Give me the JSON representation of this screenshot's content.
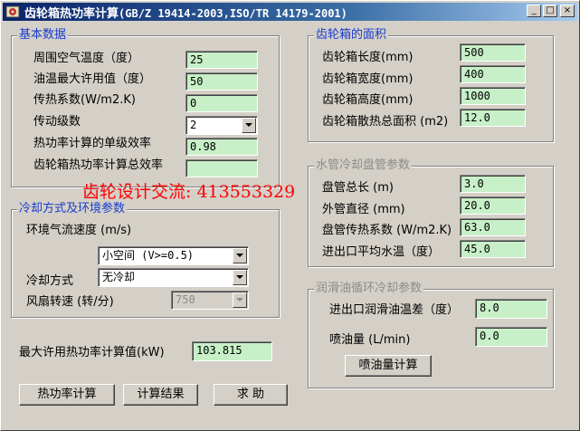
{
  "window": {
    "title_cn": "齿轮箱热功率计算",
    "title_std": "(GB/Z 19414-2003,ISO/TR 14179-2001)",
    "minimize": "_",
    "maximize": "□",
    "close": "×"
  },
  "basic": {
    "group_label": "基本数据",
    "ambient_temp_label": "周围空气温度（度）",
    "ambient_temp_value": "25",
    "max_oil_temp_label": "油温最大许用值（度）",
    "max_oil_temp_value": "50",
    "heat_coef_label": "传热系数(W/m2.K)",
    "heat_coef_value": "0",
    "stages_label": "传动级数",
    "stages_value": "2",
    "stage_eff_label": "热功率计算的单级效率",
    "stage_eff_value": "0.98",
    "total_eff_label": "齿轮箱热功率计算总效率",
    "total_eff_value": ""
  },
  "watermark": "齿轮设计交流: 413553329",
  "cooling": {
    "group_label": "冷却方式及环境参数",
    "airflow_label": "环境气流速度 (m/s)",
    "airflow_value": "小空间  (V>=0.5)",
    "method_label": "冷却方式",
    "method_value": "无冷却",
    "fan_label": "风扇转速 (转/分)",
    "fan_value": "750"
  },
  "result": {
    "max_power_label": "最大许用热功率计算值(kW)",
    "max_power_value": "103.815"
  },
  "buttons": {
    "calc": "热功率计算",
    "results": "计算结果",
    "help": "求 助",
    "oil_calc": "喷油量计算"
  },
  "area": {
    "group_label": "齿轮箱的面积",
    "length_label": "齿轮箱长度(mm)",
    "length_value": "500",
    "width_label": "齿轮箱宽度(mm)",
    "width_value": "400",
    "height_label": "齿轮箱高度(mm)",
    "height_value": "1000",
    "total_area_label": "齿轮箱散热总面积 (m2)",
    "total_area_value": "12.0"
  },
  "water": {
    "group_label": "水管冷却盘管参数",
    "coil_length_label": "盘管总长 (m)",
    "coil_length_value": "3.0",
    "outer_dia_label": "外管直径 (mm)",
    "outer_dia_value": "20.0",
    "coil_heat_label": "盘管传热系数 (W/m2.K)",
    "coil_heat_value": "63.0",
    "water_temp_label": "进出口平均水温（度）",
    "water_temp_value": "45.0"
  },
  "oil": {
    "group_label": "润滑油循环冷却参数",
    "temp_diff_label": "进出口润滑油温差（度）",
    "temp_diff_value": "8.0",
    "spray_label": "喷油量 (L/min)",
    "spray_value": "0.0"
  }
}
